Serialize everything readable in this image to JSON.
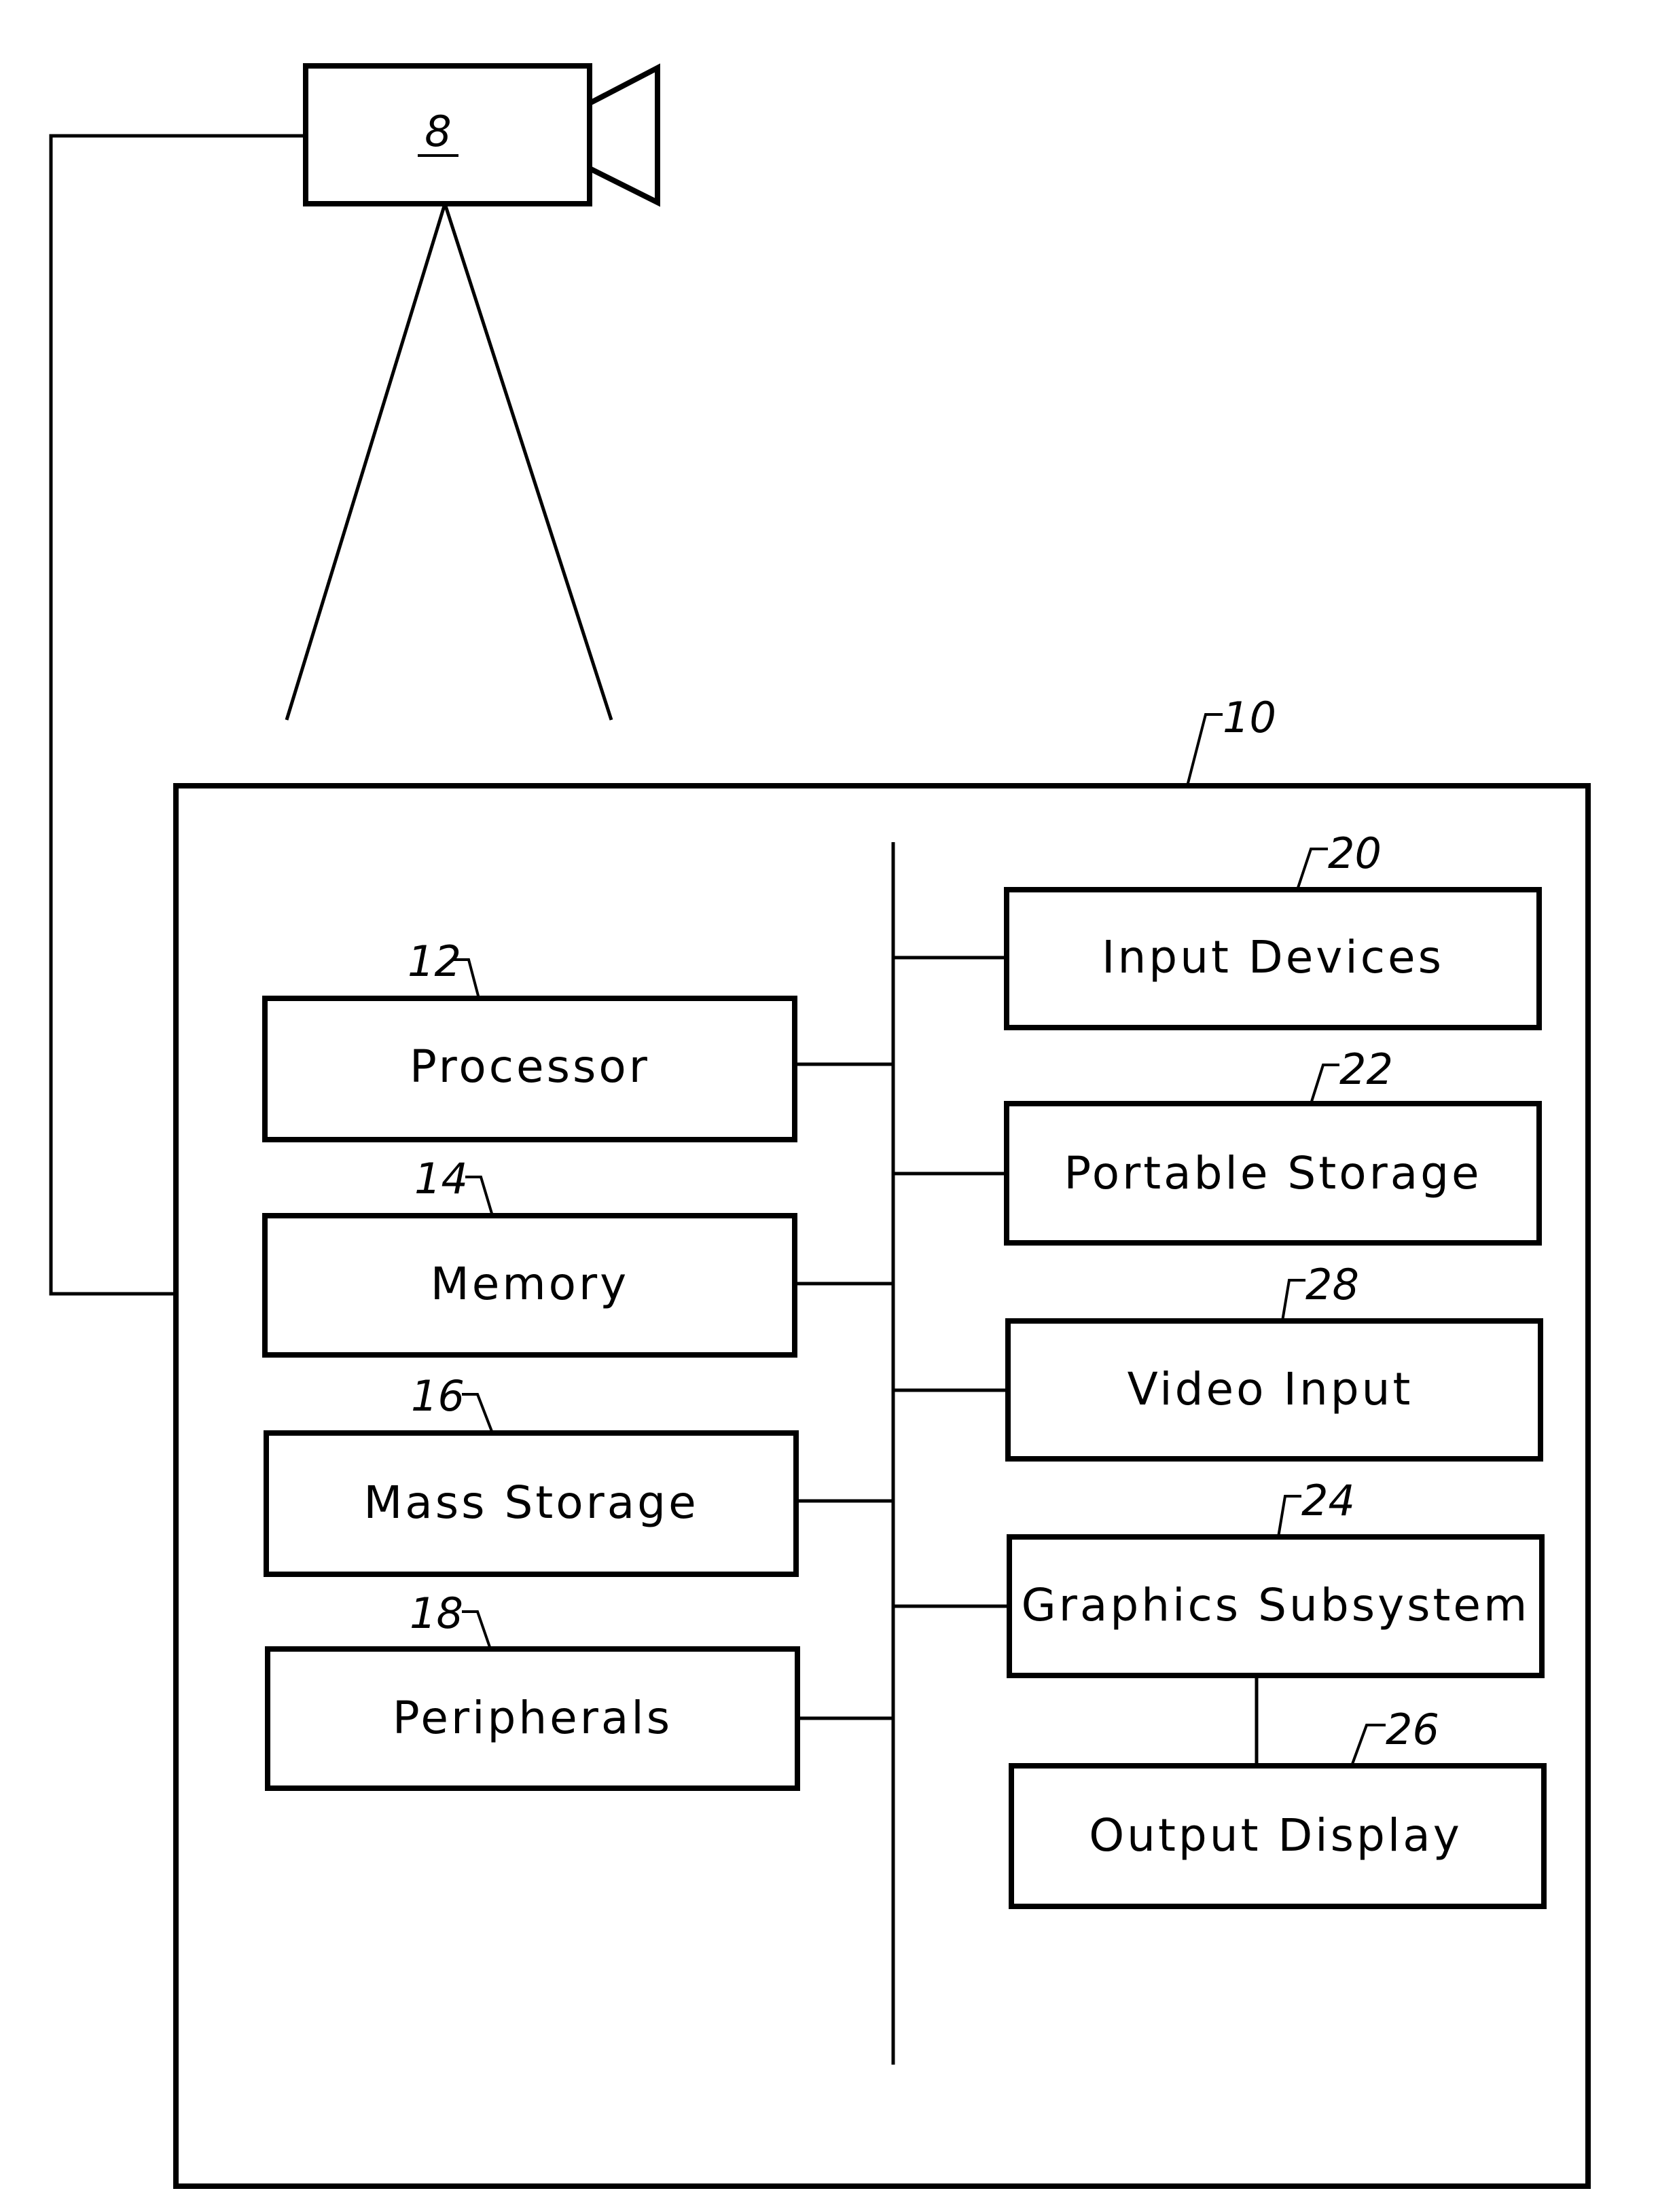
{
  "figure": {
    "camera": {
      "ref": "8",
      "name": "video camera"
    },
    "system": {
      "ref": "10"
    },
    "left_components": [
      {
        "ref": "12",
        "label": "Processor"
      },
      {
        "ref": "14",
        "label": "Memory"
      },
      {
        "ref": "16",
        "label": "Mass Storage"
      },
      {
        "ref": "18",
        "label": "Peripherals"
      }
    ],
    "right_components": [
      {
        "ref": "20",
        "label": "Input Devices"
      },
      {
        "ref": "22",
        "label": "Portable Storage"
      },
      {
        "ref": "28",
        "label": "Video Input"
      },
      {
        "ref": "24",
        "label": "Graphics Subsystem"
      },
      {
        "ref": "26",
        "label": "Output Display"
      }
    ],
    "connections": [
      "camera 8 - computer system 10",
      "Processor - bus",
      "Memory - bus",
      "Mass Storage - bus",
      "Peripherals - bus",
      "bus - Input Devices",
      "bus - Portable Storage",
      "bus - Video Input",
      "bus - Graphics Subsystem",
      "Graphics Subsystem - Output Display"
    ],
    "colors": {
      "line": "#000000",
      "background": "#ffffff"
    }
  }
}
